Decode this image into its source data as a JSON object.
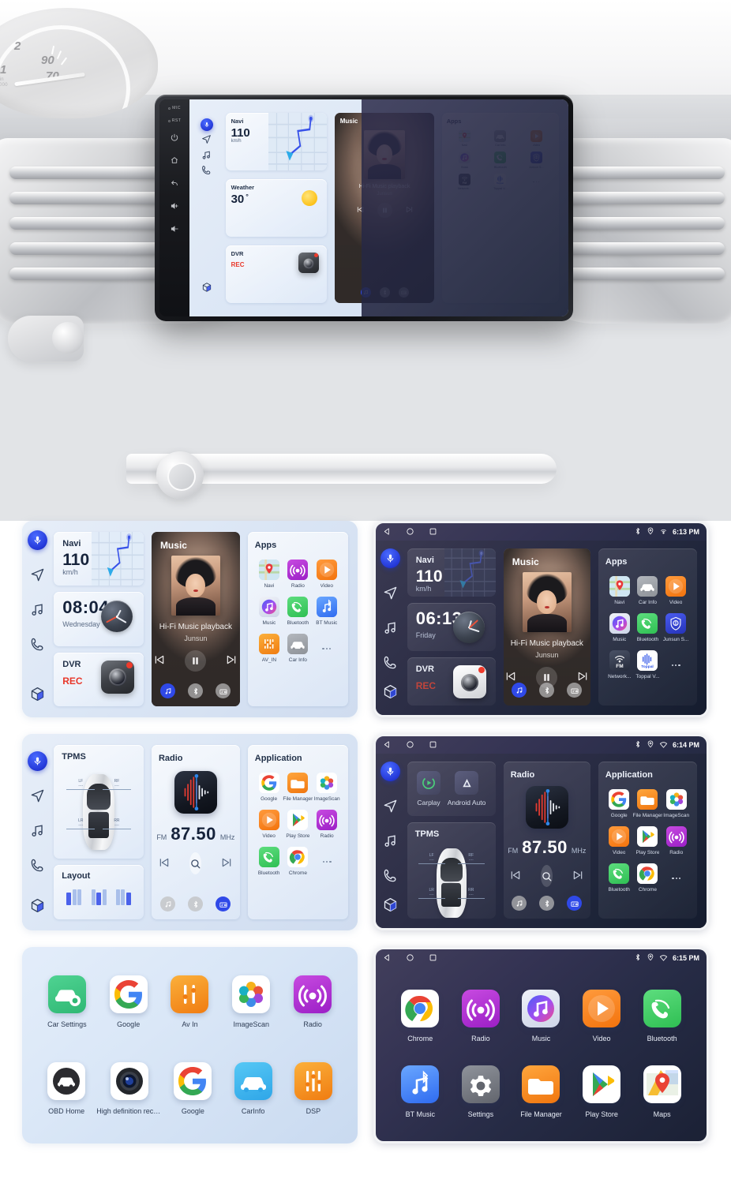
{
  "device": {
    "bezel": {
      "labels": [
        "MIC",
        "RST"
      ],
      "buttons": [
        "power-icon",
        "home-icon",
        "back-icon",
        "volume-up-icon",
        "volume-down-icon"
      ]
    },
    "sidebar": [
      {
        "name": "voice-assistant",
        "icon": "microphone-icon"
      },
      {
        "name": "navigation",
        "icon": "navigation-arrow-icon"
      },
      {
        "name": "music",
        "icon": "music-note-icon"
      },
      {
        "name": "phone",
        "icon": "phone-icon"
      },
      {
        "name": "apps",
        "icon": "apps-cube-icon"
      }
    ]
  },
  "home": {
    "navi": {
      "title": "Navi",
      "value": "110",
      "unit": "km/h"
    },
    "weather": {
      "title": "Weather",
      "value": "30",
      "unit": "°"
    },
    "dvr": {
      "title": "DVR",
      "status": "REC"
    },
    "clock_light": {
      "time": "08:04",
      "day": "Wednesday"
    },
    "clock_dark": {
      "time": "06:13",
      "day": "Friday"
    },
    "music": {
      "title": "Music",
      "track": "Hi-Fi Music playback",
      "artist": "Junsun",
      "controls": [
        "prev-icon",
        "pause-icon",
        "next-icon"
      ],
      "sources": [
        {
          "label": "music-source",
          "icon": "music-note-icon",
          "active": true
        },
        {
          "label": "bluetooth-source",
          "icon": "bluetooth-icon",
          "active": false
        },
        {
          "label": "radio-source",
          "icon": "radio-icon",
          "active": false
        }
      ]
    },
    "apps_panel": {
      "title": "Apps",
      "items_main": [
        "Navi",
        "Car Info",
        "Video",
        "Music",
        "Bluetooth",
        "Junsun S...",
        "Network...",
        "Toppal V...",
        "more"
      ],
      "items_light": [
        "Navi",
        "Radio",
        "Video",
        "Music",
        "Bluetooth",
        "BT Music",
        "AV_IN",
        "Car Info",
        "more"
      ]
    }
  },
  "second": {
    "tpms": {
      "title": "TPMS",
      "wheels": [
        {
          "pos": "LF",
          "value": "----"
        },
        {
          "pos": "RF",
          "value": "----"
        },
        {
          "pos": "LR",
          "value": "----"
        },
        {
          "pos": "RR",
          "value": "----"
        }
      ]
    },
    "layout": {
      "title": "Layout"
    },
    "projection": {
      "items": [
        {
          "label": "Carplay"
        },
        {
          "label": "Android Auto"
        }
      ]
    },
    "radio": {
      "title": "Radio",
      "band": "FM",
      "frequency": "87.50",
      "unit": "MHz",
      "controls": [
        "prev-icon",
        "search-icon",
        "next-icon"
      ],
      "sources": [
        {
          "label": "music-source",
          "icon": "music-note-icon",
          "active": false
        },
        {
          "label": "bluetooth-source",
          "icon": "bluetooth-icon",
          "active": false
        },
        {
          "label": "radio-source",
          "icon": "radio-icon",
          "active": true
        }
      ]
    },
    "application": {
      "title": "Application",
      "items": [
        "Google",
        "File Manager",
        "ImageScan",
        "Video",
        "Play Store",
        "Radio",
        "Bluetooth",
        "Chrome",
        "more"
      ]
    }
  },
  "launcher_light": {
    "row1": [
      "Car Settings",
      "Google",
      "Av In",
      "ImageScan",
      "Radio"
    ],
    "row2": [
      "OBD Home",
      "High definition recor...",
      "Google",
      "CarInfo",
      "DSP"
    ]
  },
  "launcher_dark": {
    "row1": [
      "Chrome",
      "Radio",
      "Music",
      "Video",
      "Bluetooth"
    ],
    "row2": [
      "BT Music",
      "Settings",
      "File Manager",
      "Play Store",
      "Maps"
    ]
  },
  "statusbar": {
    "nav": [
      "back-icon",
      "home-icon",
      "recents-icon"
    ],
    "icons": [
      "bluetooth-icon",
      "location-icon",
      "wifi-icon"
    ],
    "time_1": "6:13 PM",
    "time_2": "6:14 PM",
    "time_3": "6:15 PM"
  },
  "colors": {
    "accent_blue": "#2f49e8",
    "rec_red": "#e8372a",
    "light_bg": "#dae7f7",
    "dark_bg": "#2b2d45",
    "orange": "#f58220",
    "green": "#3ec45f",
    "purple": "#b23ad0"
  }
}
